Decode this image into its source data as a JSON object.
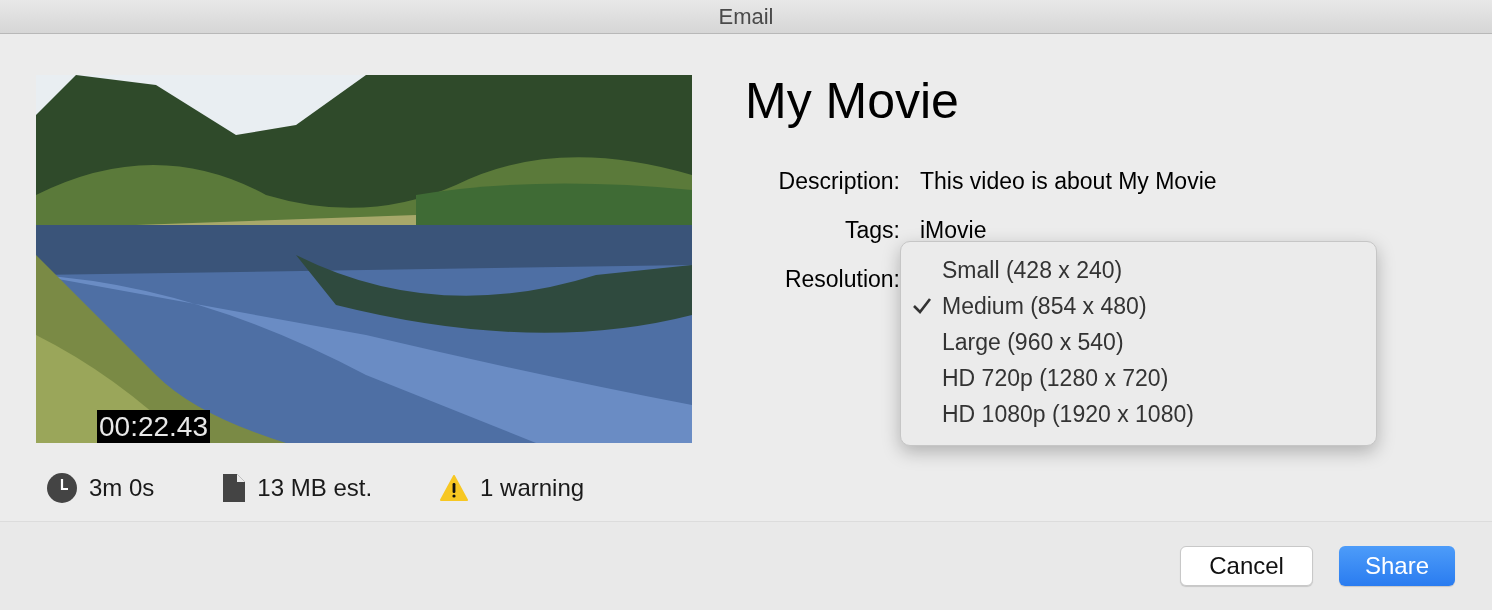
{
  "window": {
    "title": "Email"
  },
  "preview": {
    "kind": "picture",
    "timecode": "00:22.43"
  },
  "title": "My Movie",
  "fields": [
    {
      "label": "Description:",
      "value": "This video is about My Movie"
    },
    {
      "label": "Tags:",
      "value": "iMovie"
    },
    {
      "label": "Resolution:"
    }
  ],
  "resolution_menu": {
    "items": [
      {
        "label": "Small (428 x 240)",
        "selected": false
      },
      {
        "label": "Medium (854 x 480)",
        "selected": true
      },
      {
        "label": "Large (960 x 540)",
        "selected": false
      },
      {
        "label": "HD 720p (1280 x 720)",
        "selected": false
      },
      {
        "label": "HD 1080p (1920 x 1080)",
        "selected": false
      }
    ]
  },
  "stats": [
    {
      "kind": "duration",
      "text": "3m 0s"
    },
    {
      "kind": "size",
      "text": "13 MB est."
    },
    {
      "kind": "warning",
      "text": "1 warning"
    }
  ],
  "buttons": [
    {
      "label": "Cancel",
      "kind": "secondary"
    },
    {
      "label": "Share",
      "kind": "primary"
    }
  ]
}
